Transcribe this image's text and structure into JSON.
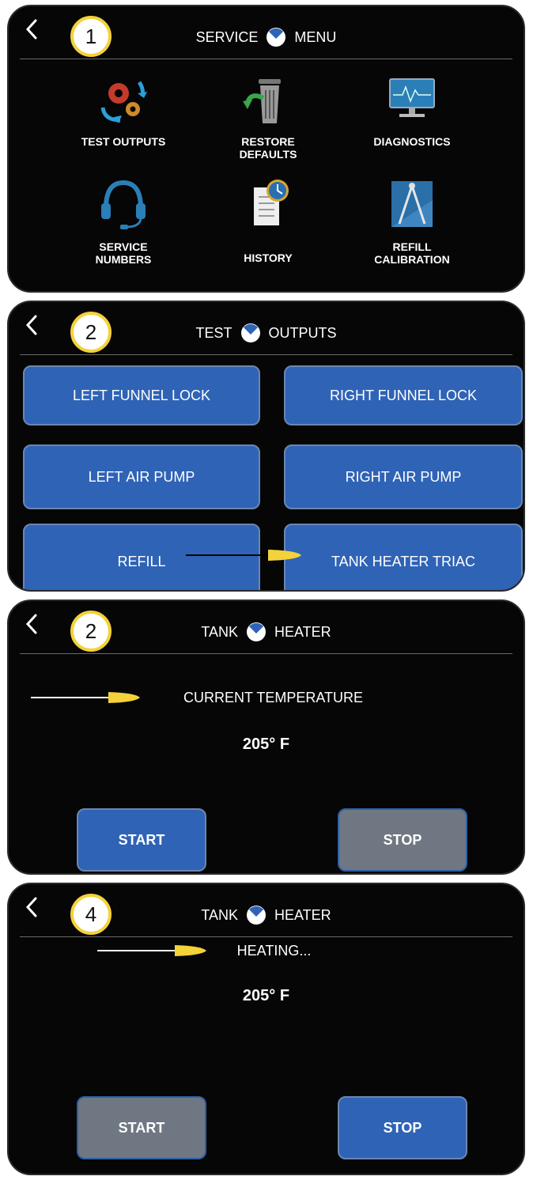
{
  "panel1": {
    "badge": "1",
    "title_left": "SERVICE",
    "title_right": "MENU",
    "items": [
      {
        "label": "TEST OUTPUTS",
        "icon": "gears-icon"
      },
      {
        "label": "RESTORE\nDEFAULTS",
        "icon": "trash-restore-icon"
      },
      {
        "label": "DIAGNOSTICS",
        "icon": "monitor-pulse-icon"
      },
      {
        "label": "SERVICE\nNUMBERS",
        "icon": "headset-icon"
      },
      {
        "label": "HISTORY",
        "icon": "notebook-clock-icon"
      },
      {
        "label": "REFILL\nCALIBRATION",
        "icon": "compass-icon"
      }
    ]
  },
  "panel2": {
    "badge": "2",
    "title_left": "TEST",
    "title_right": "OUTPUTS",
    "buttons": [
      "LEFT FUNNEL LOCK",
      "RIGHT FUNNEL LOCK",
      "LEFT AIR PUMP",
      "RIGHT AIR PUMP",
      "REFILL",
      "TANK HEATER TRIAC"
    ]
  },
  "panel3": {
    "badge": "2",
    "title_left": "TANK",
    "title_right": "HEATER",
    "status": "CURRENT TEMPERATURE",
    "temperature": "205° F",
    "start_label": "START",
    "stop_label": "STOP"
  },
  "panel4": {
    "badge": "4",
    "title_left": "TANK",
    "title_right": "HEATER",
    "status": "HEATING...",
    "temperature": "205° F",
    "start_label": "START",
    "stop_label": "STOP"
  },
  "colors": {
    "button_blue": "#2f63b6",
    "button_gray": "#6f7782",
    "badge_ring": "#f3d23a",
    "arrow_yellow": "#f3d23a",
    "logo_blue": "#2f63b6"
  }
}
